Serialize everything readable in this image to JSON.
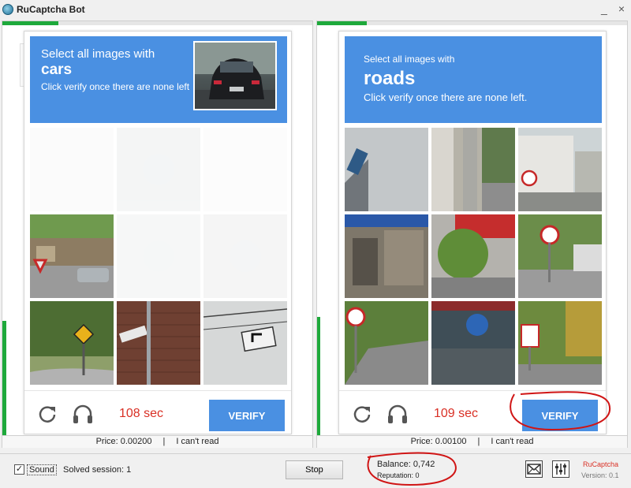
{
  "window": {
    "title": "RuCaptcha Bot",
    "minimize": "_",
    "close": "×"
  },
  "left_panel": {
    "progress": 0.18,
    "captcha": {
      "line1": "Select all images with",
      "keyword": "cars",
      "line3": "Click verify once there are none left",
      "timer": "108 sec",
      "verify": "VERIFY",
      "selected_tiles": [
        0,
        1,
        2,
        4,
        5
      ]
    },
    "status": {
      "price": "Price: 0.00200",
      "separator": "|",
      "cant_read": "I can't read"
    }
  },
  "right_panel": {
    "progress": 0.16,
    "captcha": {
      "line1": "Select all images with",
      "keyword": "roads",
      "line3": "Click verify once there are none left.",
      "timer": "109 sec",
      "verify": "VERIFY"
    },
    "status": {
      "price": "Price: 0.00100",
      "separator": "|",
      "cant_read": "I can't read"
    }
  },
  "bottom": {
    "sound_checked": true,
    "sound_label": "Sound",
    "solved_session": "Solved session:  1",
    "stop": "Stop",
    "balance": "Balance:  0,742",
    "reputation": "Reputation: 0",
    "brand": "RuCaptcha",
    "version": "Version: 0.1"
  },
  "icons": {
    "reload": "reload-icon",
    "audio": "headphones-icon",
    "mail": "mail-icon",
    "settings": "settings-icon"
  },
  "colors": {
    "captcha_blue": "#4a90e2",
    "timer_red": "#d93025",
    "progress_green": "#1ea93b",
    "annotation_red": "#d01515"
  }
}
